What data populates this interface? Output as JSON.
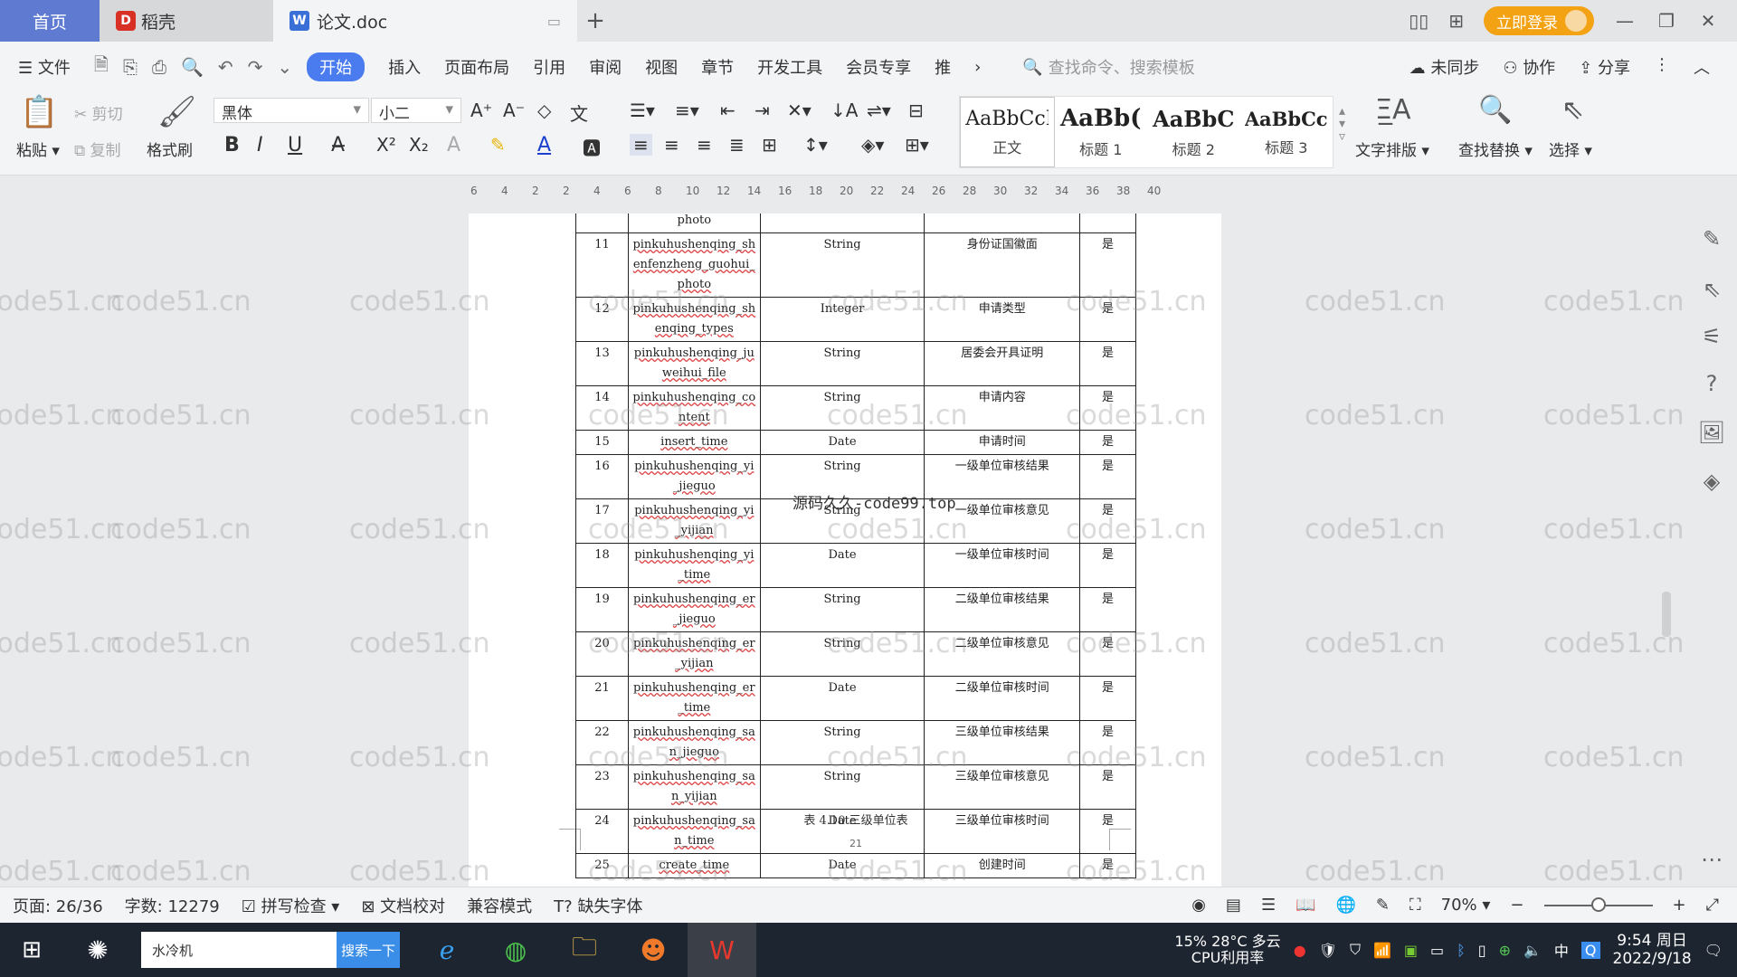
{
  "tabs": {
    "home": "首页",
    "docer": "稻壳",
    "document": "论文.doc"
  },
  "titlebar": {
    "login": "立即登录"
  },
  "menu": {
    "file": "文件",
    "items": [
      "开始",
      "插入",
      "页面布局",
      "引用",
      "审阅",
      "视图",
      "章节",
      "开发工具",
      "会员专享",
      "推"
    ],
    "search_placeholder": "查找命令、搜索模板",
    "unsynced": "未同步",
    "collab": "协作",
    "share": "分享"
  },
  "ribbon": {
    "paste": "粘贴",
    "cut": "剪切",
    "copy": "复制",
    "format_painter": "格式刷",
    "font_name": "黑体",
    "font_size": "小二",
    "styles": [
      {
        "preview": "AaBbCcI",
        "name": "正文"
      },
      {
        "preview": "AaBb(",
        "name": "标题 1"
      },
      {
        "preview": "AaBbC",
        "name": "标题 2"
      },
      {
        "preview": "AaBbCcl",
        "name": "标题 3"
      }
    ],
    "text_layout": "文字排版",
    "find_replace": "查找替换",
    "select": "选择"
  },
  "ruler": [
    "6",
    "4",
    "2",
    "2",
    "4",
    "6",
    "8",
    "10",
    "12",
    "14",
    "16",
    "18",
    "20",
    "22",
    "24",
    "26",
    "28",
    "30",
    "32",
    "34",
    "36",
    "38",
    "40"
  ],
  "table": {
    "top_fragment": "photo",
    "rows": [
      {
        "no": "11",
        "field": "pinkuhushenqing_shenfenzheng_guohui_photo",
        "type": "String",
        "desc": "身份证国徽面",
        "required": "是"
      },
      {
        "no": "12",
        "field": "pinkuhushenqing_shenqing_types",
        "type": "Integer",
        "desc": "申请类型",
        "required": "是"
      },
      {
        "no": "13",
        "field": "pinkuhushenqing_juweihui_file",
        "type": "String",
        "desc": "居委会开具证明",
        "required": "是"
      },
      {
        "no": "14",
        "field": "pinkuhushenqing_content",
        "type": "String",
        "desc": "申请内容",
        "required": "是"
      },
      {
        "no": "15",
        "field": "insert_time",
        "type": "Date",
        "desc": "申请时间",
        "required": "是"
      },
      {
        "no": "16",
        "field": "pinkuhushenqing_yi_jieguo",
        "type": "String",
        "desc": "一级单位审核结果",
        "required": "是"
      },
      {
        "no": "17",
        "field": "pinkuhushenqing_yi_yijian",
        "type": "String",
        "desc": "一级单位审核意见",
        "required": "是"
      },
      {
        "no": "18",
        "field": "pinkuhushenqing_yi_time",
        "type": "Date",
        "desc": "一级单位审核时间",
        "required": "是"
      },
      {
        "no": "19",
        "field": "pinkuhushenqing_er_jieguo",
        "type": "String",
        "desc": "二级单位审核结果",
        "required": "是"
      },
      {
        "no": "20",
        "field": "pinkuhushenqing_er_yijian",
        "type": "String",
        "desc": "二级单位审核意见",
        "required": "是"
      },
      {
        "no": "21",
        "field": "pinkuhushenqing_er_time",
        "type": "Date",
        "desc": "二级单位审核时间",
        "required": "是"
      },
      {
        "no": "22",
        "field": "pinkuhushenqing_san_jieguo",
        "type": "String",
        "desc": "三级单位审核结果",
        "required": "是"
      },
      {
        "no": "23",
        "field": "pinkuhushenqing_san_yijian",
        "type": "String",
        "desc": "三级单位审核意见",
        "required": "是"
      },
      {
        "no": "24",
        "field": "pinkuhushenqing_san_time",
        "type": "Date",
        "desc": "三级单位审核时间",
        "required": "是"
      },
      {
        "no": "25",
        "field": "create_time",
        "type": "Date",
        "desc": "创建时间",
        "required": "是"
      }
    ],
    "caption": "表 4.10 三级单位表",
    "page_number": "21"
  },
  "overlay_text": "源码久久-code99.top",
  "watermark": "code51.cn",
  "statusbar": {
    "page": "页面: 26/36",
    "words": "字数: 12279",
    "spellcheck": "拼写检查",
    "proofread": "文档校对",
    "compat": "兼容模式",
    "missing_font": "缺失字体",
    "zoom": "70%",
    "zoom_level": 0.5
  },
  "taskbar": {
    "search_text": "水冷机",
    "search_button": "搜索一下",
    "cpu_percent": "15%",
    "cpu_label": "CPU利用率",
    "weather": "28°C 多云",
    "ime": "中",
    "time": "9:54 周日",
    "date": "2022/9/18"
  },
  "colors": {
    "accent": "#4a7cf0",
    "home_tab": "#5f7bd1",
    "login": "#f3a213",
    "taskbar": "#1d2530"
  }
}
